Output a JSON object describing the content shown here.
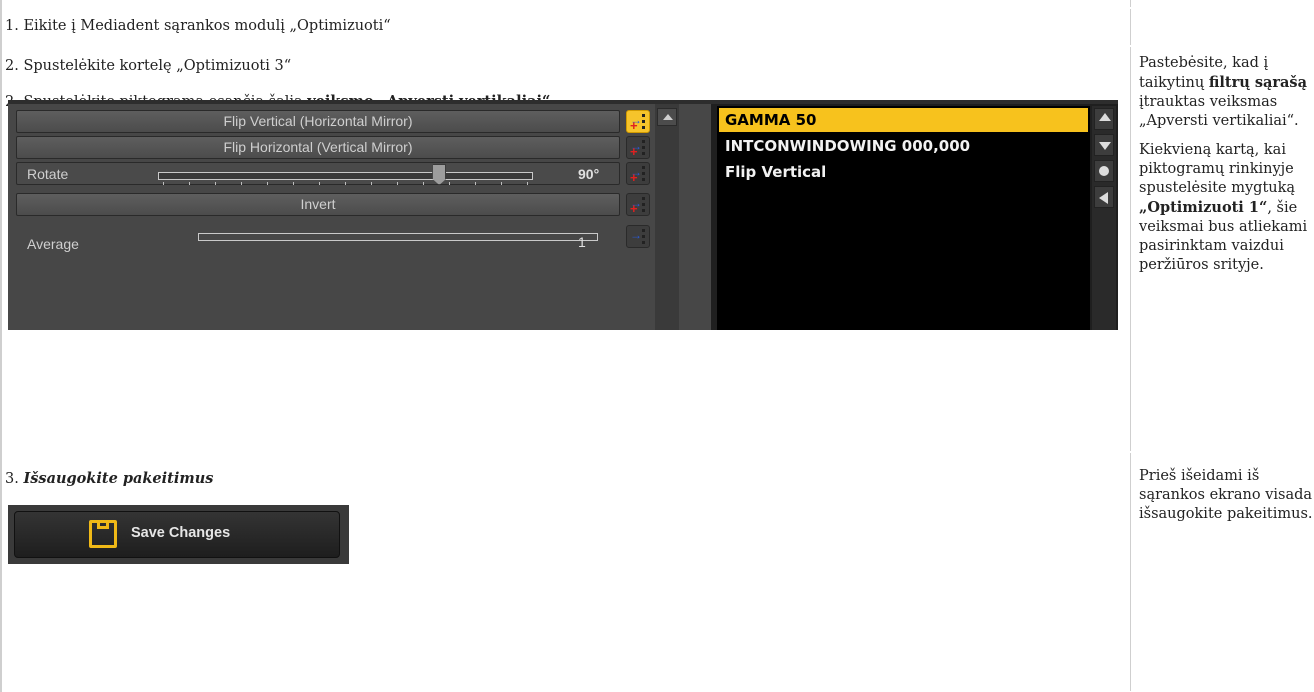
{
  "row1": {
    "text": "1. Eikite į Mediadent sąrankos modulį „Optimizuoti“"
  },
  "row2": {
    "line1": "2. Spustelėkite kortelę „Optimizuoti 3“",
    "line2_plain": "2. Spustelėkite piktogramą esančią šalia ",
    "line2_bold": "veiksmo „Apversti vertikaliai“",
    "right_p1_a": "Pastebėsite, kad į taikytinų ",
    "right_p1_b": "filtrų sąrašą",
    "right_p1_c": " įtrauktas veiksmas „Apversti vertikaliai“.",
    "right_p2_a": "Kiekvieną kartą, kai piktogramų rinkinyje spustelėsite mygtuką ",
    "right_p2_b": "„Optimizuoti 1“",
    "right_p2_c": ", šie veiksmai bus atliekami pasirinktam vaizdui peržiūros srityje."
  },
  "screenshot": {
    "buttons": [
      "Flip Vertical (Horizontal Mirror)",
      "Flip Horizontal (Vertical Mirror)",
      "Invert"
    ],
    "rotate_label": "Rotate",
    "rotate_value": "90°",
    "rotate_level": 0.75,
    "average_label": "Average",
    "average_value": "1",
    "filters": [
      "GAMMA 50",
      "INTCONWINDOWING 000,000",
      "Flip Vertical"
    ],
    "selected_filter": 0
  },
  "row3": {
    "num": "3. ",
    "title": "Išsaugokite pakeitimus",
    "save_button": "Save Changes",
    "right_text": "Prieš išeidami iš sąrankos ekrano visada išsaugokite pakeitimus."
  },
  "colors": {
    "accent": "#f7c21d",
    "border": "#cfcfcf"
  }
}
